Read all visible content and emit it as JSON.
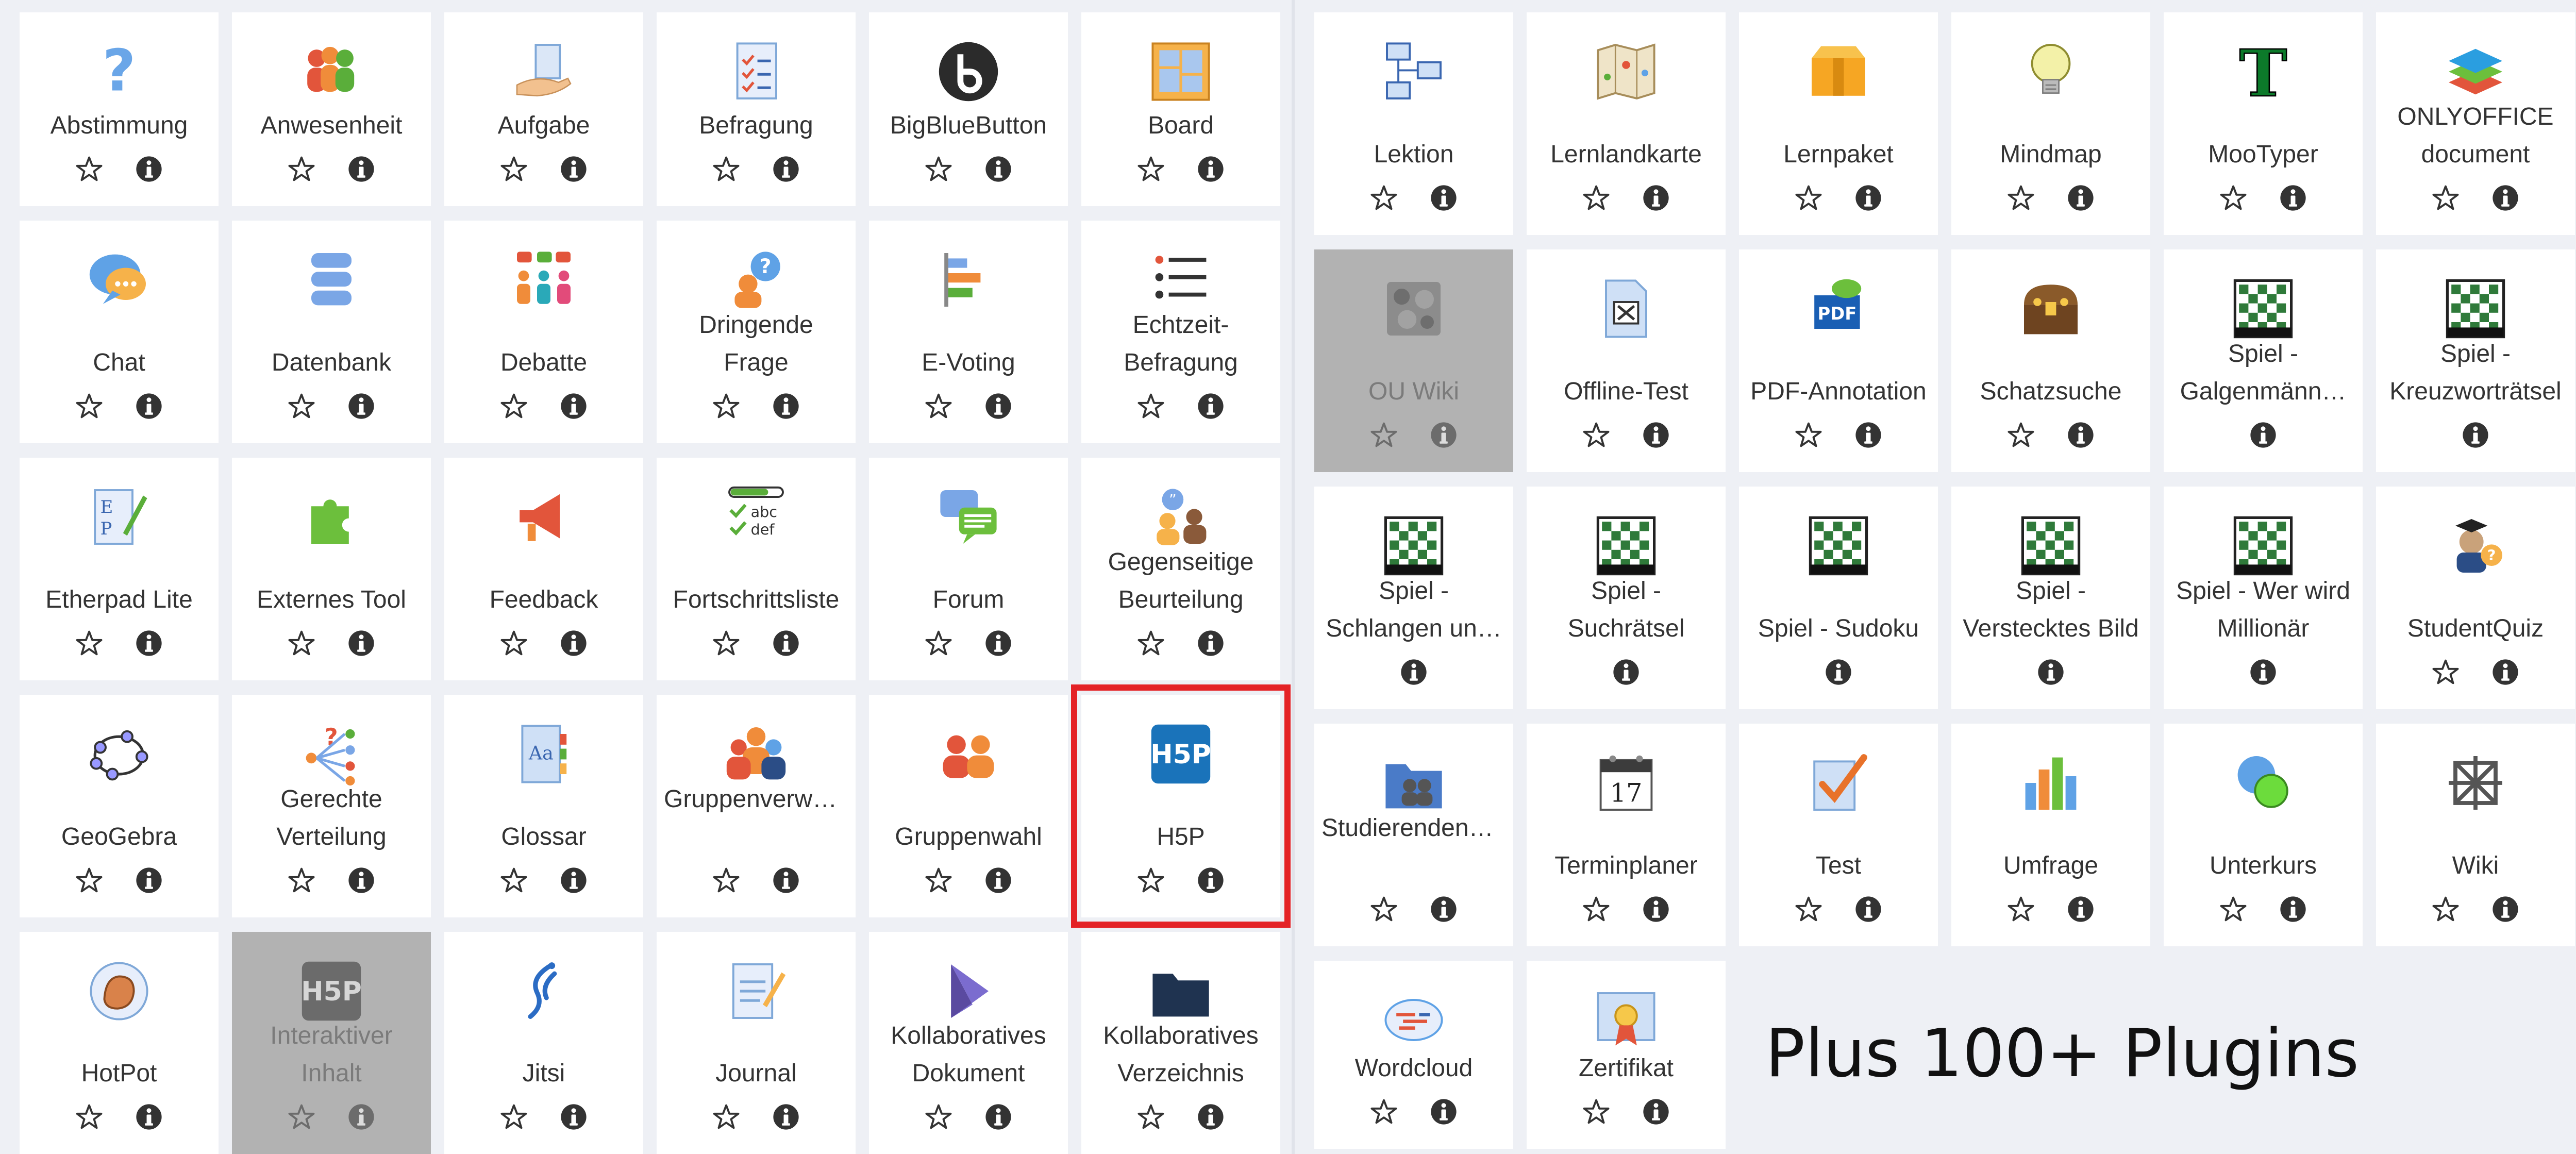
{
  "plugins_caption": "Plus 100+ Plugins",
  "colors": {
    "background": "#eef0f5",
    "tile": "#ffffff",
    "disabled_tile": "#b2b2b2",
    "highlight": "#e42226",
    "action_icon": "#333333"
  },
  "left_panel": {
    "tiles": [
      {
        "label": "Abstimmung",
        "icon": "question-icon"
      },
      {
        "label": "Anwesenheit",
        "icon": "people-group-icon"
      },
      {
        "label": "Aufgabe",
        "icon": "hand-document-icon"
      },
      {
        "label": "Befragung",
        "icon": "checklist-icon"
      },
      {
        "label": "BigBlueButton",
        "icon": "bigbluebutton-icon"
      },
      {
        "label": "Board",
        "icon": "board-icon"
      },
      {
        "label": "Chat",
        "icon": "chat-bubble-icon"
      },
      {
        "label": "Datenbank",
        "icon": "database-icon"
      },
      {
        "label": "Debatte",
        "icon": "debate-icon"
      },
      {
        "label": "Dringende Frage",
        "icon": "urgent-question-icon"
      },
      {
        "label": "E-Voting",
        "icon": "bar-chart-horizontal-icon"
      },
      {
        "label": "Echtzeit-Befragung",
        "icon": "list-icon"
      },
      {
        "label": "Etherpad Lite",
        "icon": "etherpad-icon"
      },
      {
        "label": "Externes Tool",
        "icon": "puzzle-icon"
      },
      {
        "label": "Feedback",
        "icon": "megaphone-icon"
      },
      {
        "label": "Fortschrittsliste",
        "icon": "checkbox-list-icon"
      },
      {
        "label": "Forum",
        "icon": "forum-bubbles-icon"
      },
      {
        "label": "Gegenseitige Beurteilung",
        "icon": "peer-review-icon"
      },
      {
        "label": "GeoGebra",
        "icon": "geogebra-icon"
      },
      {
        "label": "Gerechte Verteilung",
        "icon": "distribution-icon"
      },
      {
        "label": "Glossar",
        "icon": "glossary-icon"
      },
      {
        "label": "Gruppenverwaltung",
        "icon": "group-management-icon"
      },
      {
        "label": "Gruppenwahl",
        "icon": "group-choice-icon"
      },
      {
        "label": "H5P",
        "icon": "h5p-icon"
      },
      {
        "label": "HotPot",
        "icon": "hotpot-icon"
      },
      {
        "label": "Interaktiver Inhalt",
        "icon": "h5p-grey-icon"
      },
      {
        "label": "Jitsi",
        "icon": "jitsi-icon"
      },
      {
        "label": "Journal",
        "icon": "journal-icon"
      },
      {
        "label": "Kollaboratives Dokument",
        "icon": "collab-document-icon"
      },
      {
        "label": "Kollaboratives Verzeichnis",
        "icon": "folder-icon"
      }
    ]
  },
  "right_panel": {
    "tiles": [
      {
        "label": "Lektion",
        "icon": "lesson-flow-icon"
      },
      {
        "label": "Lernlandkarte",
        "icon": "map-icon"
      },
      {
        "label": "Lernpaket",
        "icon": "package-icon"
      },
      {
        "label": "Mindmap",
        "icon": "lightbulb-icon"
      },
      {
        "label": "MooTyper",
        "icon": "mootyper-icon"
      },
      {
        "label": "ONLYOFFICE document",
        "icon": "onlyoffice-icon"
      },
      {
        "label": "OU Wiki",
        "icon": "ou-wiki-icon"
      },
      {
        "label": "Offline-Test",
        "icon": "offline-test-icon"
      },
      {
        "label": "PDF-Annotation",
        "icon": "pdf-icon"
      },
      {
        "label": "Schatzsuche",
        "icon": "treasure-chest-icon"
      },
      {
        "label": "Spiel - Galgenmänn…",
        "icon": "game-grid-icon"
      },
      {
        "label": "Spiel - Kreuzworträtsel",
        "icon": "game-grid-icon"
      },
      {
        "label": "Spiel - Schlangen un…",
        "icon": "game-grid-icon"
      },
      {
        "label": "Spiel - Suchrätsel",
        "icon": "game-grid-icon"
      },
      {
        "label": "Spiel - Sudoku",
        "icon": "game-grid-icon"
      },
      {
        "label": "Spiel - Verstecktes Bild",
        "icon": "game-grid-icon"
      },
      {
        "label": "Spiel - Wer wird Millionär",
        "icon": "game-grid-icon"
      },
      {
        "label": "StudentQuiz",
        "icon": "student-quiz-icon"
      },
      {
        "label": "Studierendenordner",
        "icon": "student-folder-icon"
      },
      {
        "label": "Terminplaner",
        "icon": "calendar-icon"
      },
      {
        "label": "Test",
        "icon": "test-check-icon"
      },
      {
        "label": "Umfrage",
        "icon": "survey-chart-icon"
      },
      {
        "label": "Unterkurs",
        "icon": "subcourse-icon"
      },
      {
        "label": "Wiki",
        "icon": "wiki-icon"
      },
      {
        "label": "Wordcloud",
        "icon": "wordcloud-icon"
      },
      {
        "label": "Zertifikat",
        "icon": "certificate-icon"
      }
    ]
  }
}
